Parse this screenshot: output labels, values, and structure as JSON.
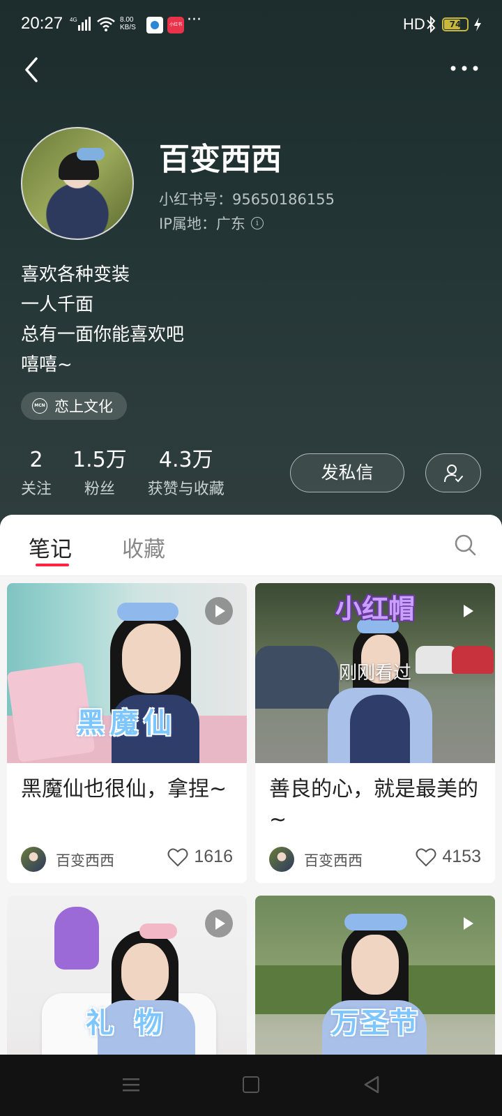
{
  "status_bar": {
    "time": "20:27",
    "network": "4G",
    "speed_value": "8.00",
    "speed_unit": "KB/S",
    "app2_label": "小红书",
    "more": "···",
    "hd": "HD",
    "battery": "74"
  },
  "profile": {
    "nickname": "百变西西",
    "red_id": "小红书号：95650186155",
    "ip_location": "IP属地：广东",
    "bio_lines": [
      "喜欢各种变装",
      "一人千面",
      "总有一面你能喜欢吧",
      "嘻嘻~"
    ],
    "mcn_icon": "MCN",
    "mcn_label": "恋上文化",
    "stats": [
      {
        "value": "2",
        "label": "关注"
      },
      {
        "value": "1.5万",
        "label": "粉丝"
      },
      {
        "value": "4.3万",
        "label": "获赞与收藏"
      }
    ],
    "message_button": "发私信"
  },
  "tabs": [
    {
      "label": "笔记",
      "active": true
    },
    {
      "label": "收藏",
      "active": false
    }
  ],
  "notes": [
    {
      "overlay": "黑魔仙",
      "title": "黑魔仙也很仙，拿捏~",
      "author": "百变西西",
      "likes": "1616",
      "is_video": true
    },
    {
      "top_overlay": "小红帽",
      "seen_label": "刚刚看过",
      "title": "善良的心，就是最美的~",
      "author": "百变西西",
      "likes": "4153",
      "is_video": true
    },
    {
      "overlay": "礼 物",
      "is_video": true
    },
    {
      "overlay": "万圣节",
      "is_video": true
    }
  ],
  "colors": {
    "accent": "#ff2442",
    "header_bg": "#223434"
  }
}
